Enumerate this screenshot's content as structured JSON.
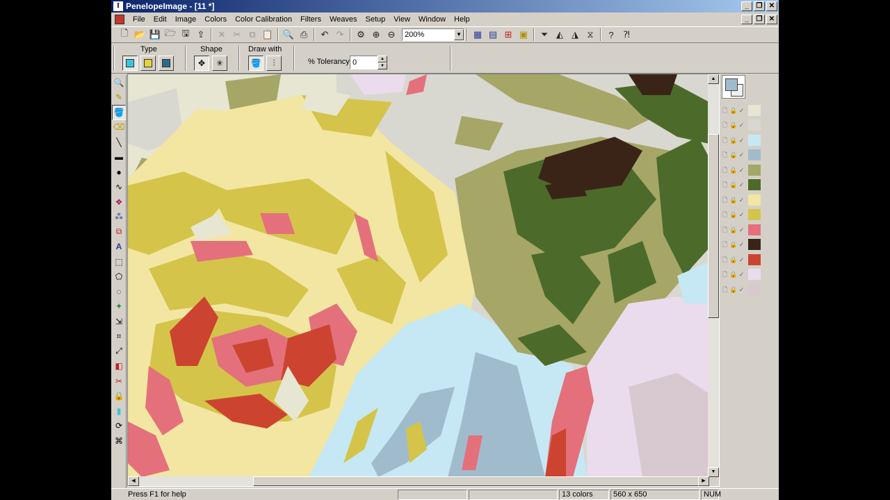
{
  "window": {
    "title": "PenelopeImage - [11 *]",
    "app_icon_glyph": "I"
  },
  "menu": {
    "items": [
      "File",
      "Edit",
      "Image",
      "Colors",
      "Color Calibration",
      "Filters",
      "Weaves",
      "Setup",
      "View",
      "Window",
      "Help"
    ]
  },
  "toolbar": {
    "zoom_value": "200%"
  },
  "options": {
    "type_label": "Type",
    "shape_label": "Shape",
    "draw_with_label": "Draw with",
    "tolerance_label": "% Tolerancy:",
    "tolerance_value": "0"
  },
  "palette": {
    "colors": [
      "#e6e6d2",
      "#d8d8d0",
      "#c6e8f4",
      "#a0bccc",
      "#a6a667",
      "#4c6b2a",
      "#f2e6a2",
      "#d4c44a",
      "#e4707c",
      "#3a2418",
      "#cc4430",
      "#eadcec",
      "#d8c8d0"
    ]
  },
  "status": {
    "help_text": "Press F1 for help",
    "colors_count": "13 colors",
    "dimensions": "560 x 650",
    "num_lock": "NUM"
  }
}
